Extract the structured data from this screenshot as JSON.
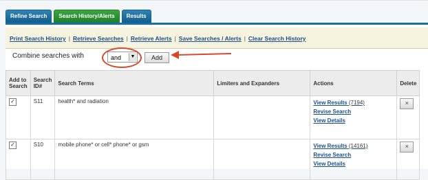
{
  "tabs": [
    "Refine Search",
    "Search History/Alerts",
    "Results"
  ],
  "toolbar": {
    "links": [
      "Print Search History",
      "Retrieve Searches",
      "Retrieve Alerts",
      "Save Searches / Alerts",
      "Clear Search History"
    ],
    "separators": [
      "|",
      "|",
      "|",
      "|"
    ]
  },
  "combine": {
    "label": "Combine searches with",
    "selected": "and",
    "add_label": "Add"
  },
  "table": {
    "headers": [
      "Add to Search",
      "Search ID#",
      "Search Terms",
      "Limiters and Expanders",
      "Actions",
      "Delete"
    ],
    "rows": [
      {
        "checked": true,
        "id": "S11",
        "terms": "health* and radiation",
        "limiters": "",
        "actions": [
          "View Results",
          "Revise Search",
          "View Details"
        ],
        "count": "(7194)",
        "delete": "×"
      },
      {
        "checked": true,
        "id": "S10",
        "terms": "mobile phone* or cell* phone* or gsm",
        "limiters": "",
        "actions": [
          "View Results",
          "Revise Search",
          "View Details"
        ],
        "count": "(14161)",
        "delete": "×"
      }
    ]
  },
  "colors": {
    "accent": "#1a6fa4",
    "active_tab": "#2b9635",
    "highlight": "#d8482a"
  }
}
